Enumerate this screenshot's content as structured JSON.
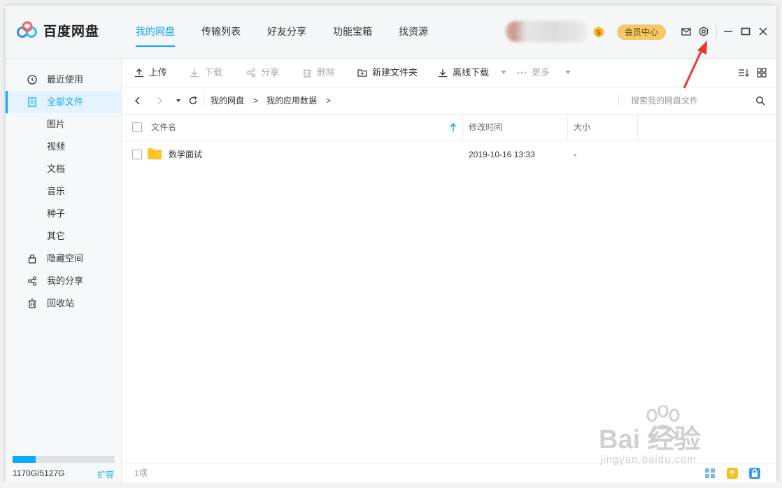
{
  "app": {
    "brand": "百度网盘",
    "nav": [
      "我的网盘",
      "传输列表",
      "好友分享",
      "功能宝箱",
      "找资源"
    ],
    "active_nav_index": 0,
    "vip_label": "会员中心",
    "coin_badge": "S"
  },
  "sidebar": {
    "items": [
      {
        "label": "最近使用",
        "icon": "clock-icon"
      },
      {
        "label": "全部文件",
        "icon": "document-icon"
      },
      {
        "label": "图片"
      },
      {
        "label": "视频"
      },
      {
        "label": "文档"
      },
      {
        "label": "音乐"
      },
      {
        "label": "种子"
      },
      {
        "label": "其它"
      },
      {
        "label": "隐藏空间",
        "icon": "lock-icon"
      },
      {
        "label": "我的分享",
        "icon": "share-icon"
      },
      {
        "label": "回收站",
        "icon": "trash-icon"
      }
    ],
    "active_index": 1,
    "storage_text": "1170G/5127G",
    "storage_used_fraction": 0.228,
    "expand_label": "扩容"
  },
  "toolbar": {
    "upload": "上传",
    "download": "下载",
    "share": "分享",
    "delete": "删除",
    "new_folder": "新建文件夹",
    "offline_download": "离线下载",
    "more": "更多"
  },
  "address": {
    "crumbs": [
      "我的网盘",
      "我的应用数据"
    ],
    "separator": ">",
    "search_placeholder": "搜索我的网盘文件"
  },
  "table": {
    "columns": [
      "文件名",
      "修改时间",
      "大小"
    ],
    "rows": [
      {
        "name": "数学面试",
        "modified": "2019-10-16 13:33",
        "size": "-"
      }
    ]
  },
  "status": {
    "count": "1项"
  },
  "watermark": {
    "text": "Bai 经验",
    "url_text": "jingyan.baidu.com"
  },
  "colors": {
    "accent": "#09aaff",
    "vip": "#f3c969",
    "folder": "#ffc42b",
    "annotation": "#e8392f"
  }
}
